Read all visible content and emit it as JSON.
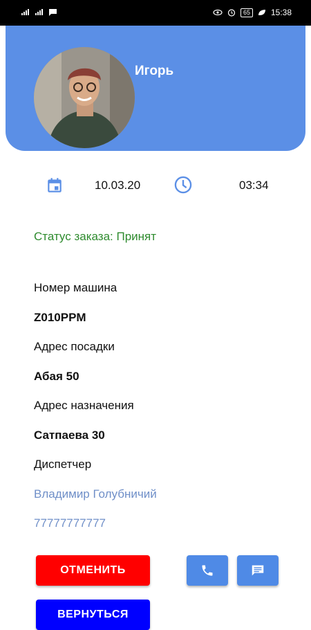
{
  "status_bar": {
    "time": "15:38",
    "battery": "65"
  },
  "header": {
    "user_name": "Игорь",
    "accent_color": "#5b8fe6"
  },
  "order": {
    "date": "10.03.20",
    "time": "03:34",
    "status": "Статус заказа: Принят"
  },
  "details": {
    "car_number_label": "Номер машина",
    "car_number": "Z010PPM",
    "pickup_label": "Адрес посадки",
    "pickup": "Абая 50",
    "destination_label": "Адрес назначения",
    "destination": "Сатпаева 30",
    "dispatcher_label": "Диспетчер",
    "dispatcher_name": "Владимир Голубничий",
    "dispatcher_phone": "77777777777"
  },
  "actions": {
    "cancel_label": "ОТМЕНИТЬ",
    "return_label": "ВЕРНУТЬСЯ",
    "call_icon": "phone-icon",
    "message_icon": "message-icon"
  }
}
